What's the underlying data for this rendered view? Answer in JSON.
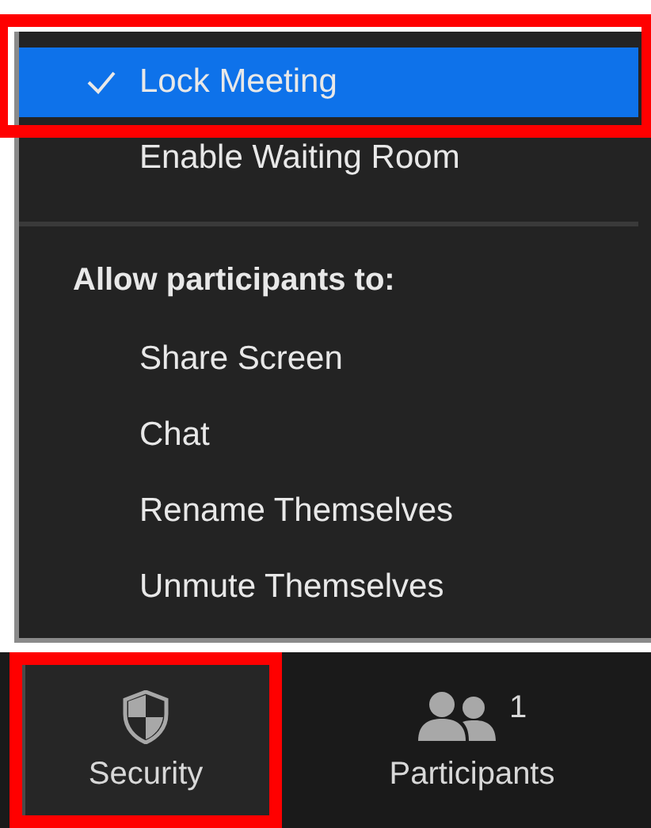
{
  "menu": {
    "items": [
      {
        "label": "Lock Meeting",
        "checked": true,
        "selected": true,
        "outlined": true
      },
      {
        "label": "Enable Waiting Room",
        "checked": false,
        "selected": false,
        "outlined": false
      }
    ],
    "section": {
      "title": "Allow participants to:",
      "items": [
        {
          "label": "Share Screen",
          "checked": false
        },
        {
          "label": "Chat",
          "checked": false
        },
        {
          "label": "Rename Themselves",
          "checked": false
        },
        {
          "label": "Unmute Themselves",
          "checked": false
        }
      ]
    }
  },
  "toolbar": {
    "buttons": [
      {
        "kind": "security",
        "label": "Security",
        "outlined": true
      },
      {
        "kind": "participants",
        "label": "Participants",
        "count": "1",
        "outlined": false
      }
    ]
  }
}
